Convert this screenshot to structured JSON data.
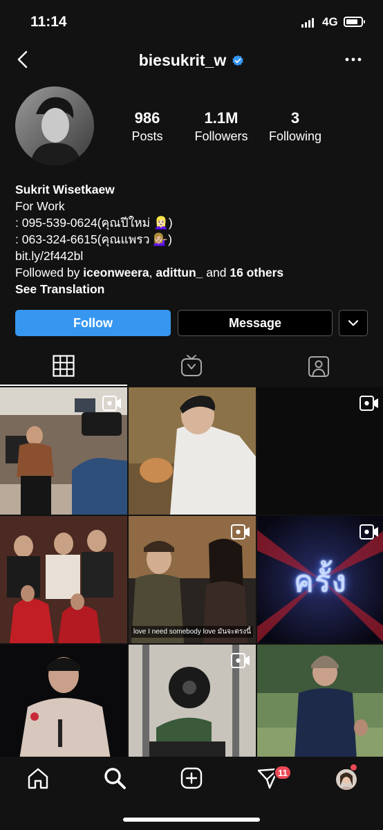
{
  "status_bar": {
    "time": "11:14",
    "network": "4G"
  },
  "header": {
    "username": "biesukrit_w"
  },
  "profile": {
    "stats": [
      {
        "value": "986",
        "label": "Posts"
      },
      {
        "value": "1.1M",
        "label": "Followers"
      },
      {
        "value": "3",
        "label": "Following"
      }
    ],
    "bio": {
      "name": "Sukrit Wisetkaew",
      "lines": [
        "For Work",
        ": 095-539-0624(คุณปีใหม่ 👱🏻‍♀️)",
        ": 063-324-6615(คุณแพรว 💁🏼‍♀️)",
        "bit.ly/2f442bl"
      ],
      "followed_prefix": "Followed by",
      "followed_user1": "iceonweera",
      "followed_sep": ",",
      "followed_user2": "adittun_",
      "followed_and": "and",
      "followed_others": "16 others",
      "see_translation": "See Translation"
    }
  },
  "actions": {
    "follow": "Follow",
    "message": "Message"
  },
  "grid": {
    "overlay_text": "ครั้ง",
    "caption": "love I need somebody love มันจะตรงนี้"
  },
  "bottom_nav": {
    "activity_badge": "11"
  },
  "colors": {
    "accent": "#3797f0",
    "background": "#121212",
    "badge": "#ed4956"
  }
}
